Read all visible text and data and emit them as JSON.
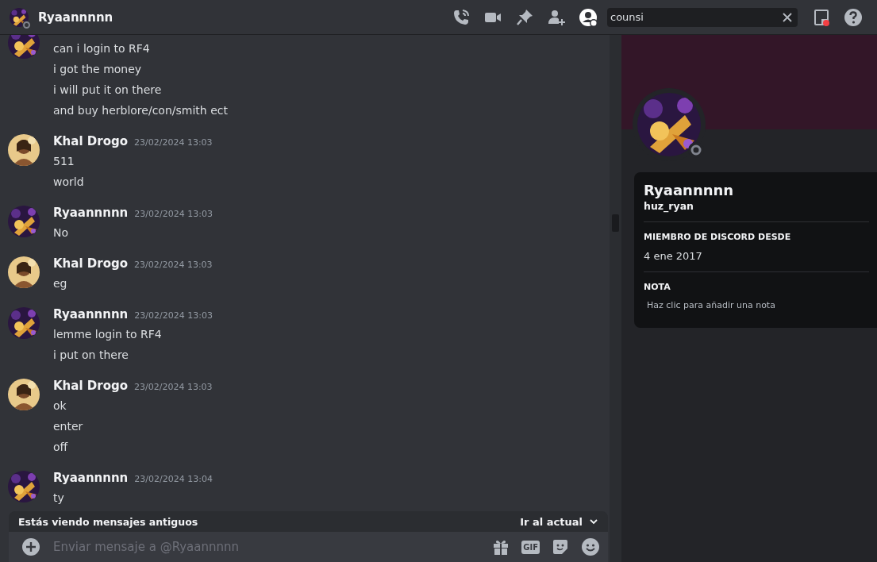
{
  "header": {
    "name": "Ryaannnnn",
    "search": {
      "value": "counsi"
    }
  },
  "messages": [
    {
      "kind": "ryan",
      "lines": [
        "can i login to RF4",
        "i got the money",
        "i will put it on there",
        "and buy herblore/con/smith ect"
      ]
    },
    {
      "kind": "drogo",
      "author": "Khal Drogo",
      "time": "23/02/2024 13:03",
      "lines": [
        "511",
        "world"
      ]
    },
    {
      "kind": "ryan",
      "author": "Ryaannnnn",
      "time": "23/02/2024 13:03",
      "lines": [
        "No"
      ]
    },
    {
      "kind": "drogo",
      "author": "Khal Drogo",
      "time": "23/02/2024 13:03",
      "lines": [
        "eg"
      ]
    },
    {
      "kind": "ryan",
      "author": "Ryaannnnn",
      "time": "23/02/2024 13:03",
      "lines": [
        "lemme login to RF4",
        "i put on there"
      ]
    },
    {
      "kind": "drogo",
      "author": "Khal Drogo",
      "time": "23/02/2024 13:03",
      "lines": [
        "ok",
        "enter",
        "off"
      ]
    },
    {
      "kind": "ryan",
      "author": "Ryaannnnn",
      "time": "23/02/2024 13:04",
      "lines": [
        "ty"
      ]
    }
  ],
  "old_banner": {
    "text": "Estás viendo mensajes antiguos",
    "action": "Ir al actual"
  },
  "composer": {
    "placeholder": "Enviar mensaje a @Ryaannnnn",
    "gif": "GIF"
  },
  "profile": {
    "display_name": "Ryaannnnn",
    "username": "huz_ryan",
    "sections": [
      {
        "title": "MIEMBRO DE DISCORD DESDE",
        "kind": "text",
        "body": "4 ene 2017"
      },
      {
        "title": "NOTA",
        "kind": "note",
        "body": "Haz clic para añadir una nota"
      }
    ]
  }
}
